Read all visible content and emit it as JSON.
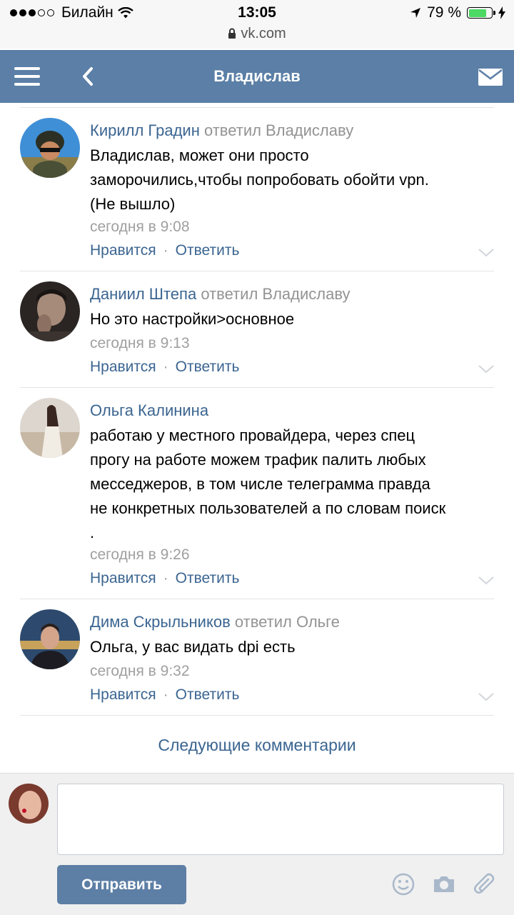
{
  "status_bar": {
    "carrier": "Билайн",
    "time": "13:05",
    "battery": "79 %",
    "battery_level": 0.79,
    "url": "vk.com"
  },
  "header": {
    "title": "Владислав"
  },
  "comments": [
    {
      "author": "Кирилл Градин",
      "reply_to": "ответил Владиславу",
      "lines": [
        "Владислав, может они просто",
        "заморочились,чтобы попробовать обойти vpn.",
        "(Не вышло)"
      ],
      "time": "сегодня в 9:08",
      "like": "Нравится",
      "reply": "Ответить"
    },
    {
      "author": "Даниил Штепа",
      "reply_to": "ответил Владиславу",
      "lines": [
        "Но это настройки>основное"
      ],
      "time": "сегодня в 9:13",
      "like": "Нравится",
      "reply": "Ответить"
    },
    {
      "author": "Ольга Калинина",
      "reply_to": "",
      "lines": [
        "работаю у местного провайдера, через спец",
        "прогу на работе можем трафик палить любых",
        "месседжеров, в том числе телеграмма правда",
        "не конкретных пользователей а по словам поиск",
        "."
      ],
      "time": "сегодня в 9:26",
      "like": "Нравится",
      "reply": "Ответить"
    },
    {
      "author": "Дима Скрыльников",
      "reply_to": "ответил Ольге",
      "lines": [
        "Ольга, у вас видать dpi есть"
      ],
      "time": "сегодня в 9:32",
      "like": "Нравится",
      "reply": "Ответить"
    }
  ],
  "more_comments": "Следующие комментарии",
  "composer": {
    "text": "",
    "send_label": "Отправить"
  },
  "colors": {
    "header": "#5b7fa6",
    "link": "#3b6591",
    "muted": "#a0a0a0",
    "button": "#5d7fa5"
  },
  "icons": [
    "menu-icon",
    "back-icon",
    "mail-icon",
    "chevron-down-icon",
    "smile-icon",
    "camera-icon",
    "paperclip-icon",
    "wifi-icon",
    "location-icon",
    "lock-icon",
    "charging-icon"
  ]
}
